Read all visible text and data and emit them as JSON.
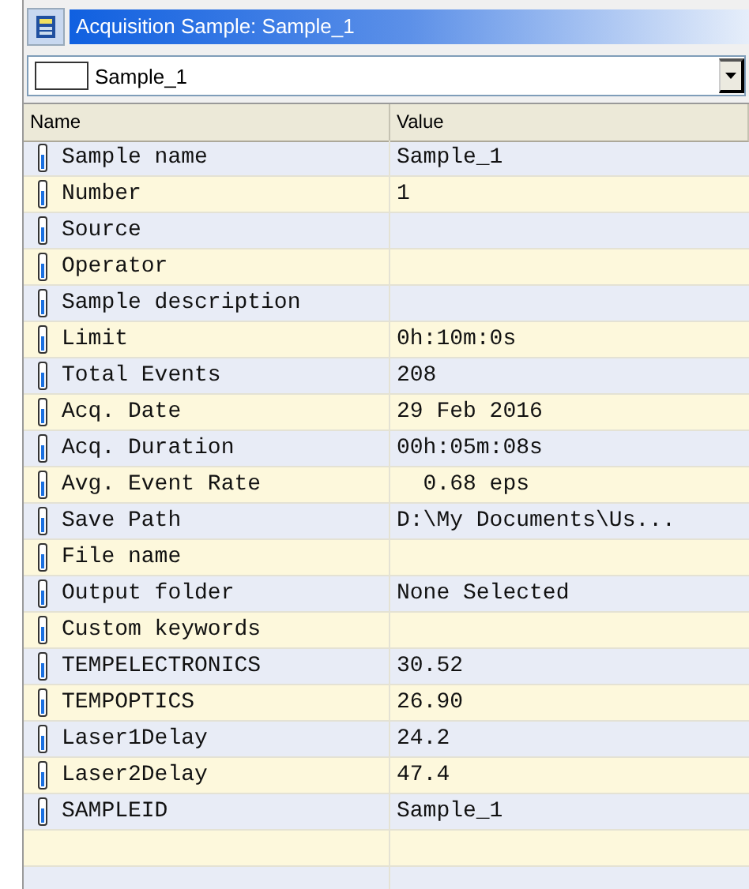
{
  "window": {
    "title": "Acquisition Sample: Sample_1"
  },
  "selector": {
    "value": "Sample_1"
  },
  "table": {
    "columns": [
      "Name",
      "Value"
    ],
    "rows": [
      {
        "name": "Sample name",
        "value": "Sample_1"
      },
      {
        "name": "Number",
        "value": "1"
      },
      {
        "name": "Source",
        "value": ""
      },
      {
        "name": "Operator",
        "value": ""
      },
      {
        "name": "Sample description",
        "value": ""
      },
      {
        "name": "Limit",
        "value": "0h:10m:0s"
      },
      {
        "name": "Total Events",
        "value": "208"
      },
      {
        "name": "Acq. Date",
        "value": "29 Feb 2016"
      },
      {
        "name": "Acq. Duration",
        "value": "00h:05m:08s"
      },
      {
        "name": "Avg. Event Rate",
        "value": "  0.68 eps"
      },
      {
        "name": "Save Path",
        "value": "D:\\My Documents\\Us..."
      },
      {
        "name": "File name",
        "value": ""
      },
      {
        "name": "Output folder",
        "value": "None Selected"
      },
      {
        "name": "Custom keywords",
        "value": ""
      },
      {
        "name": "TEMPELECTRONICS",
        "value": "30.52"
      },
      {
        "name": "TEMPOPTICS",
        "value": "26.90"
      },
      {
        "name": "Laser1Delay",
        "value": "24.2"
      },
      {
        "name": "Laser2Delay",
        "value": "47.4"
      },
      {
        "name": "SAMPLEID",
        "value": "Sample_1"
      }
    ]
  }
}
